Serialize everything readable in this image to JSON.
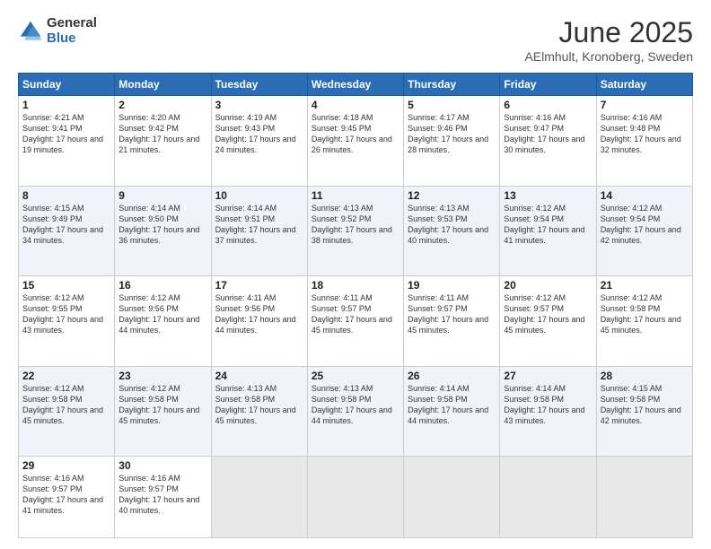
{
  "logo": {
    "general": "General",
    "blue": "Blue"
  },
  "header": {
    "month": "June 2025",
    "location": "AElmhult, Kronoberg, Sweden"
  },
  "weekdays": [
    "Sunday",
    "Monday",
    "Tuesday",
    "Wednesday",
    "Thursday",
    "Friday",
    "Saturday"
  ],
  "weeks": [
    [
      {
        "day": "1",
        "sunrise": "4:21 AM",
        "sunset": "9:41 PM",
        "daylight": "17 hours and 19 minutes."
      },
      {
        "day": "2",
        "sunrise": "4:20 AM",
        "sunset": "9:42 PM",
        "daylight": "17 hours and 21 minutes."
      },
      {
        "day": "3",
        "sunrise": "4:19 AM",
        "sunset": "9:43 PM",
        "daylight": "17 hours and 24 minutes."
      },
      {
        "day": "4",
        "sunrise": "4:18 AM",
        "sunset": "9:45 PM",
        "daylight": "17 hours and 26 minutes."
      },
      {
        "day": "5",
        "sunrise": "4:17 AM",
        "sunset": "9:46 PM",
        "daylight": "17 hours and 28 minutes."
      },
      {
        "day": "6",
        "sunrise": "4:16 AM",
        "sunset": "9:47 PM",
        "daylight": "17 hours and 30 minutes."
      },
      {
        "day": "7",
        "sunrise": "4:16 AM",
        "sunset": "9:48 PM",
        "daylight": "17 hours and 32 minutes."
      }
    ],
    [
      {
        "day": "8",
        "sunrise": "4:15 AM",
        "sunset": "9:49 PM",
        "daylight": "17 hours and 34 minutes."
      },
      {
        "day": "9",
        "sunrise": "4:14 AM",
        "sunset": "9:50 PM",
        "daylight": "17 hours and 36 minutes."
      },
      {
        "day": "10",
        "sunrise": "4:14 AM",
        "sunset": "9:51 PM",
        "daylight": "17 hours and 37 minutes."
      },
      {
        "day": "11",
        "sunrise": "4:13 AM",
        "sunset": "9:52 PM",
        "daylight": "17 hours and 38 minutes."
      },
      {
        "day": "12",
        "sunrise": "4:13 AM",
        "sunset": "9:53 PM",
        "daylight": "17 hours and 40 minutes."
      },
      {
        "day": "13",
        "sunrise": "4:12 AM",
        "sunset": "9:54 PM",
        "daylight": "17 hours and 41 minutes."
      },
      {
        "day": "14",
        "sunrise": "4:12 AM",
        "sunset": "9:54 PM",
        "daylight": "17 hours and 42 minutes."
      }
    ],
    [
      {
        "day": "15",
        "sunrise": "4:12 AM",
        "sunset": "9:55 PM",
        "daylight": "17 hours and 43 minutes."
      },
      {
        "day": "16",
        "sunrise": "4:12 AM",
        "sunset": "9:56 PM",
        "daylight": "17 hours and 44 minutes."
      },
      {
        "day": "17",
        "sunrise": "4:11 AM",
        "sunset": "9:56 PM",
        "daylight": "17 hours and 44 minutes."
      },
      {
        "day": "18",
        "sunrise": "4:11 AM",
        "sunset": "9:57 PM",
        "daylight": "17 hours and 45 minutes."
      },
      {
        "day": "19",
        "sunrise": "4:11 AM",
        "sunset": "9:57 PM",
        "daylight": "17 hours and 45 minutes."
      },
      {
        "day": "20",
        "sunrise": "4:12 AM",
        "sunset": "9:57 PM",
        "daylight": "17 hours and 45 minutes."
      },
      {
        "day": "21",
        "sunrise": "4:12 AM",
        "sunset": "9:58 PM",
        "daylight": "17 hours and 45 minutes."
      }
    ],
    [
      {
        "day": "22",
        "sunrise": "4:12 AM",
        "sunset": "9:58 PM",
        "daylight": "17 hours and 45 minutes."
      },
      {
        "day": "23",
        "sunrise": "4:12 AM",
        "sunset": "9:58 PM",
        "daylight": "17 hours and 45 minutes."
      },
      {
        "day": "24",
        "sunrise": "4:13 AM",
        "sunset": "9:58 PM",
        "daylight": "17 hours and 45 minutes."
      },
      {
        "day": "25",
        "sunrise": "4:13 AM",
        "sunset": "9:58 PM",
        "daylight": "17 hours and 44 minutes."
      },
      {
        "day": "26",
        "sunrise": "4:14 AM",
        "sunset": "9:58 PM",
        "daylight": "17 hours and 44 minutes."
      },
      {
        "day": "27",
        "sunrise": "4:14 AM",
        "sunset": "9:58 PM",
        "daylight": "17 hours and 43 minutes."
      },
      {
        "day": "28",
        "sunrise": "4:15 AM",
        "sunset": "9:58 PM",
        "daylight": "17 hours and 42 minutes."
      }
    ],
    [
      {
        "day": "29",
        "sunrise": "4:16 AM",
        "sunset": "9:57 PM",
        "daylight": "17 hours and 41 minutes."
      },
      {
        "day": "30",
        "sunrise": "4:16 AM",
        "sunset": "9:57 PM",
        "daylight": "17 hours and 40 minutes."
      },
      null,
      null,
      null,
      null,
      null
    ]
  ]
}
